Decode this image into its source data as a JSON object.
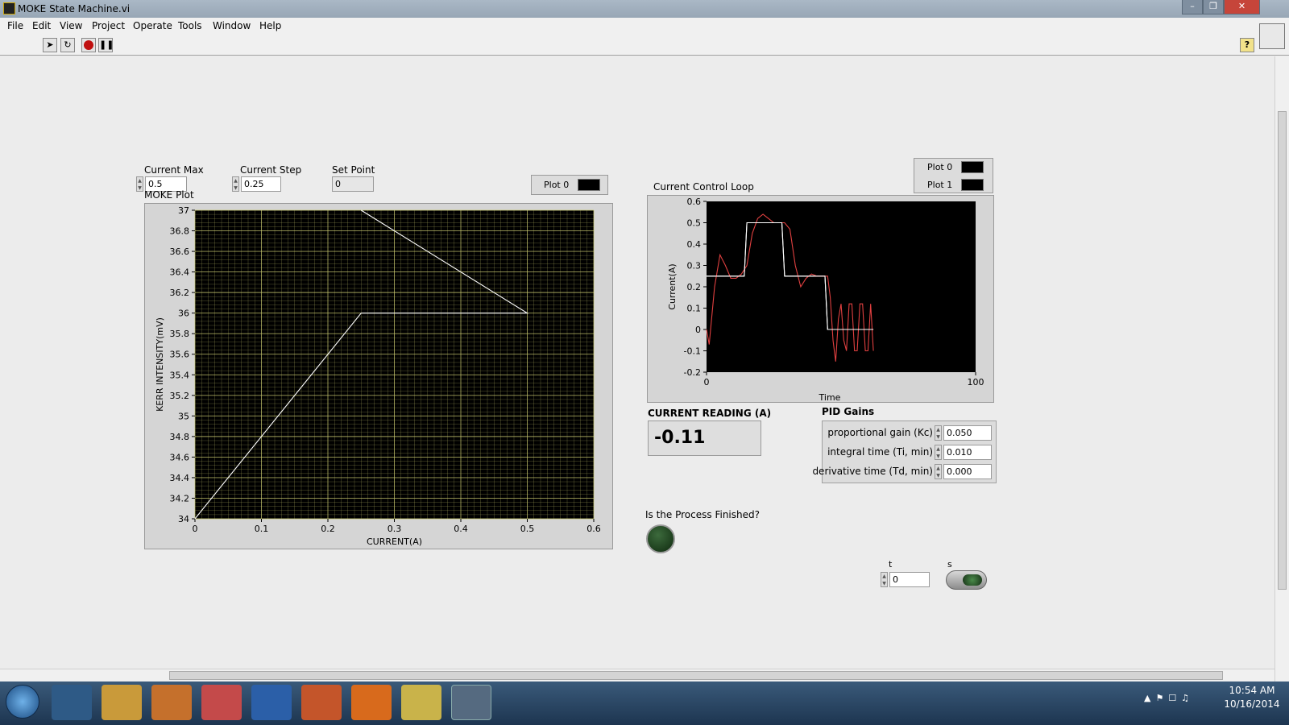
{
  "window": {
    "title": "MOKE State Machine.vi"
  },
  "menu": [
    "File",
    "Edit",
    "View",
    "Project",
    "Operate",
    "Tools",
    "Window",
    "Help"
  ],
  "toolbar": {
    "run": "run-arrow",
    "run_continuous": "run-continuous",
    "abort": "abort",
    "pause": "pause",
    "help": "?"
  },
  "controls": {
    "current_max": {
      "label": "Current Max",
      "value": "0.5"
    },
    "current_step": {
      "label": "Current Step",
      "value": "0.25"
    },
    "set_point": {
      "label": "Set Point",
      "value": "0"
    }
  },
  "moke_plot": {
    "label": "MOKE Plot",
    "legend": "Plot 0"
  },
  "ccl_plot": {
    "label": "Current Control Loop",
    "legend": [
      "Plot 0",
      "Plot 1"
    ]
  },
  "current_reading": {
    "label": "CURRENT READING (A)",
    "value": "-0.11"
  },
  "pid": {
    "title": "PID Gains",
    "rows": [
      {
        "label": "proportional gain (Kc)",
        "value": "0.050"
      },
      {
        "label": "integral time (Ti, min)",
        "value": "0.010"
      },
      {
        "label": "derivative time (Td, min)",
        "value": "0.000"
      }
    ]
  },
  "finished": {
    "label": "Is the Process Finished?"
  },
  "t": {
    "label": "t",
    "value": "0"
  },
  "s": {
    "label": "s"
  },
  "clock": {
    "time": "10:54 AM",
    "date": "10/16/2014"
  },
  "colors": {
    "grid": "#c8c870",
    "trace": "#ffffff",
    "trace2": "#e04040",
    "panel": "#ececec",
    "led": "#1e3c1e"
  },
  "chart_data": [
    {
      "type": "line",
      "title": "MOKE Plot",
      "xlabel": "CURRENT(A)",
      "ylabel": "KERR INTENSITY(mV)",
      "xlim": [
        0,
        0.6
      ],
      "ylim": [
        34,
        37
      ],
      "xticks": [
        "0",
        "0.1",
        "0.2",
        "0.3",
        "0.4",
        "0.5",
        "0.6"
      ],
      "yticks": [
        "34",
        "34.2",
        "34.4",
        "34.6",
        "34.8",
        "35",
        "35.2",
        "35.4",
        "35.6",
        "35.8",
        "36",
        "36.2",
        "36.4",
        "36.6",
        "36.8",
        "37"
      ],
      "grid": true,
      "series": [
        {
          "name": "Plot 0",
          "x": [
            0,
            0.25,
            0.5,
            0.25
          ],
          "y": [
            34,
            36,
            36,
            37
          ]
        }
      ]
    },
    {
      "type": "line",
      "title": "Current Control Loop",
      "xlabel": "Time",
      "ylabel": "Current(A)",
      "xlim": [
        0,
        100
      ],
      "ylim": [
        -0.2,
        0.6
      ],
      "xticks": [
        "0",
        "100"
      ],
      "yticks": [
        "-0.2",
        "-0.1",
        "0",
        "0.1",
        "0.2",
        "0.3",
        "0.4",
        "0.5",
        "0.6"
      ],
      "grid": false,
      "series": [
        {
          "name": "Plot 0",
          "x": [
            0,
            14,
            15,
            20,
            21,
            28,
            29,
            44,
            45,
            62
          ],
          "y": [
            0.25,
            0.25,
            0.5,
            0.5,
            0.5,
            0.5,
            0.25,
            0.25,
            0,
            0
          ]
        },
        {
          "name": "Plot 1",
          "x": [
            0,
            1,
            3,
            5,
            7,
            9,
            11,
            13,
            15,
            17,
            19,
            21,
            23,
            25,
            27,
            29,
            31,
            33,
            35,
            37,
            39,
            41,
            43,
            45,
            46,
            47,
            48,
            49,
            50,
            51,
            52,
            53,
            54,
            55,
            56,
            57,
            58,
            59,
            60,
            61,
            62
          ],
          "y": [
            0.0,
            -0.07,
            0.2,
            0.35,
            0.3,
            0.24,
            0.24,
            0.26,
            0.3,
            0.45,
            0.52,
            0.54,
            0.52,
            0.5,
            0.5,
            0.5,
            0.47,
            0.3,
            0.2,
            0.24,
            0.26,
            0.25,
            0.25,
            0.25,
            0.15,
            -0.05,
            -0.15,
            0.05,
            0.12,
            -0.05,
            -0.1,
            0.12,
            0.12,
            -0.1,
            -0.1,
            0.12,
            0.12,
            -0.1,
            -0.1,
            0.12,
            -0.1
          ]
        }
      ]
    }
  ]
}
